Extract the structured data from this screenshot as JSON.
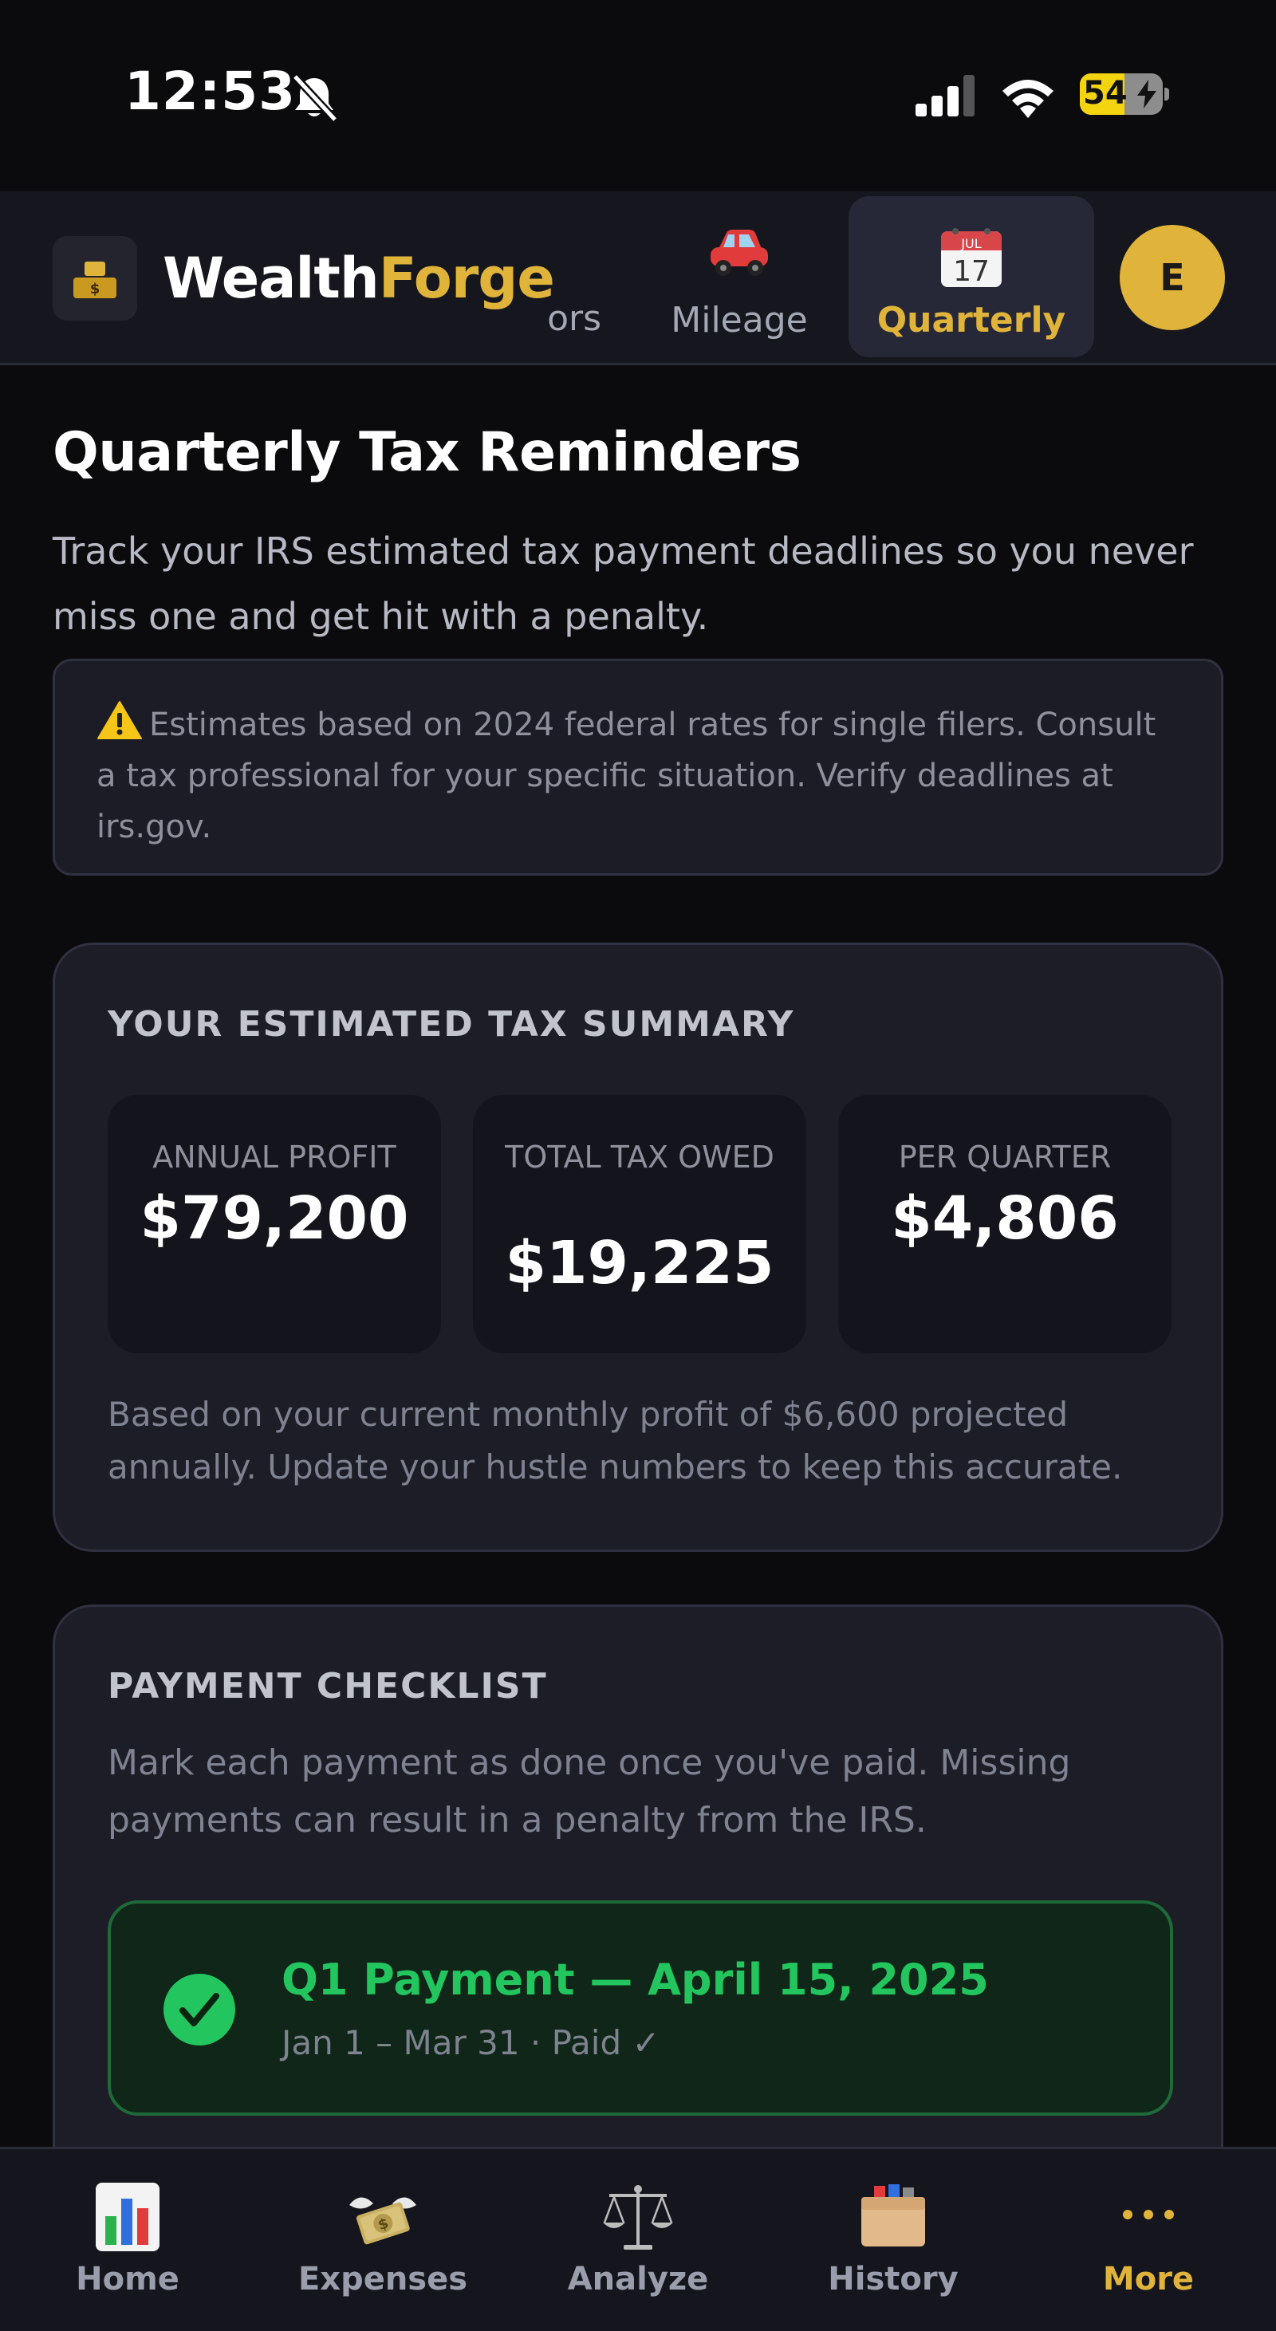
{
  "status_bar": {
    "time": "12:53",
    "battery": "54",
    "battery_level": 0.54
  },
  "header": {
    "brand_primary": "Wealth",
    "brand_accent": "Forge",
    "partial_tab_label": "ors",
    "tabs": [
      {
        "label": "Mileage",
        "icon": "car-icon"
      },
      {
        "label": "Quarterly",
        "icon": "calendar-icon",
        "active": true
      }
    ],
    "avatar_initial": "E"
  },
  "page": {
    "title": "Quarterly Tax Reminders",
    "subtitle": "Track your IRS estimated tax payment deadlines so you never miss one and get hit with a penalty.",
    "disclaimer": "Estimates based on 2024 federal rates for single filers. Consult a tax professional for your specific situation. Verify deadlines at irs.gov."
  },
  "summary": {
    "title": "YOUR ESTIMATED TAX SUMMARY",
    "stats": [
      {
        "label": "ANNUAL PROFIT",
        "value": "$79,200"
      },
      {
        "label": "TOTAL TAX OWED",
        "value": "$19,225"
      },
      {
        "label": "PER QUARTER",
        "value": "$4,806"
      }
    ],
    "note": "Based on your current monthly profit of $6,600 projected annually. Update your hustle numbers to keep this accurate."
  },
  "checklist": {
    "title": "PAYMENT CHECKLIST",
    "description": "Mark each payment as done once you've paid. Missing payments can result in a penalty from the IRS.",
    "items": [
      {
        "title": "Q1 Payment — April 15, 2025",
        "subtitle": "Jan 1 – Mar 31 · Paid ✓",
        "status": "paid"
      }
    ]
  },
  "bottom_nav": [
    {
      "label": "Home",
      "icon": "bar-chart-icon"
    },
    {
      "label": "Expenses",
      "icon": "money-wings-icon"
    },
    {
      "label": "Analyze",
      "icon": "scales-icon"
    },
    {
      "label": "History",
      "icon": "card-file-box-icon"
    },
    {
      "label": "More",
      "icon": "more-dots-icon",
      "active": true
    }
  ],
  "colors": {
    "background": "#0b0b0e",
    "accent_gold": "#e0b43a",
    "success_green": "#22c55e",
    "card_bg": "#1c1d27"
  }
}
